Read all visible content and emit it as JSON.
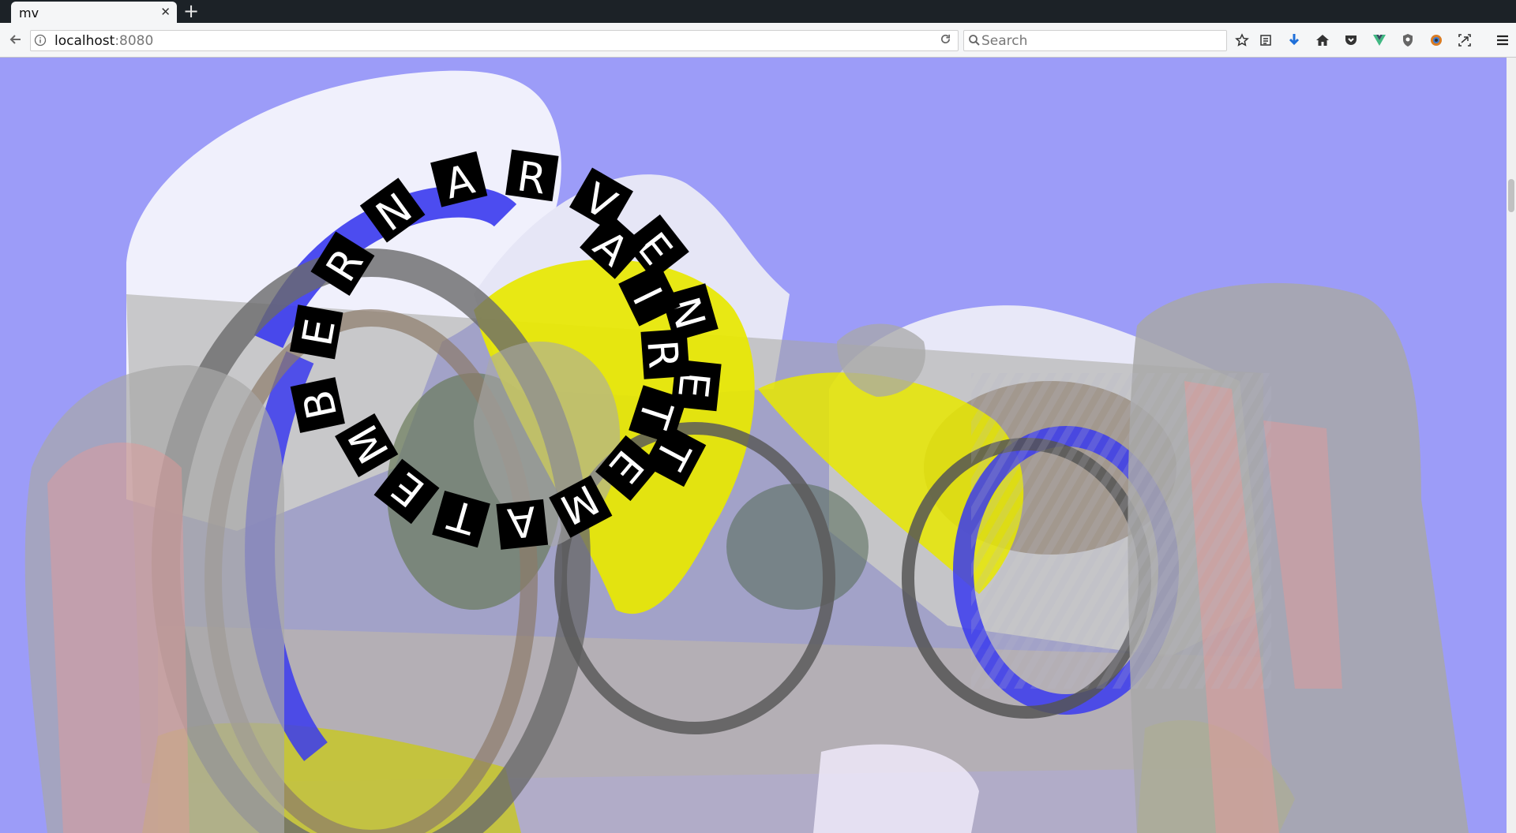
{
  "browser": {
    "tab": {
      "title": "mv"
    },
    "address": {
      "host": "localhost",
      "port": ":8080"
    },
    "search": {
      "placeholder": "Search"
    }
  },
  "artwork": {
    "circular_text_outer": [
      "B",
      "E",
      "R",
      "N",
      "A",
      "R",
      "V",
      "E",
      "N",
      "E",
      "T"
    ],
    "circular_text_inner": [
      "M",
      "E",
      "T",
      "A",
      "M",
      "E",
      "T",
      "R",
      "I",
      "A"
    ],
    "colors": {
      "background": "#9c9cf8",
      "blob_yellow": "#e8e800",
      "blob_blue": "#3a3aee",
      "blob_gray": "#a8a8a8",
      "blob_salmon": "#e09a9a",
      "blob_white": "#eeeefc"
    }
  }
}
